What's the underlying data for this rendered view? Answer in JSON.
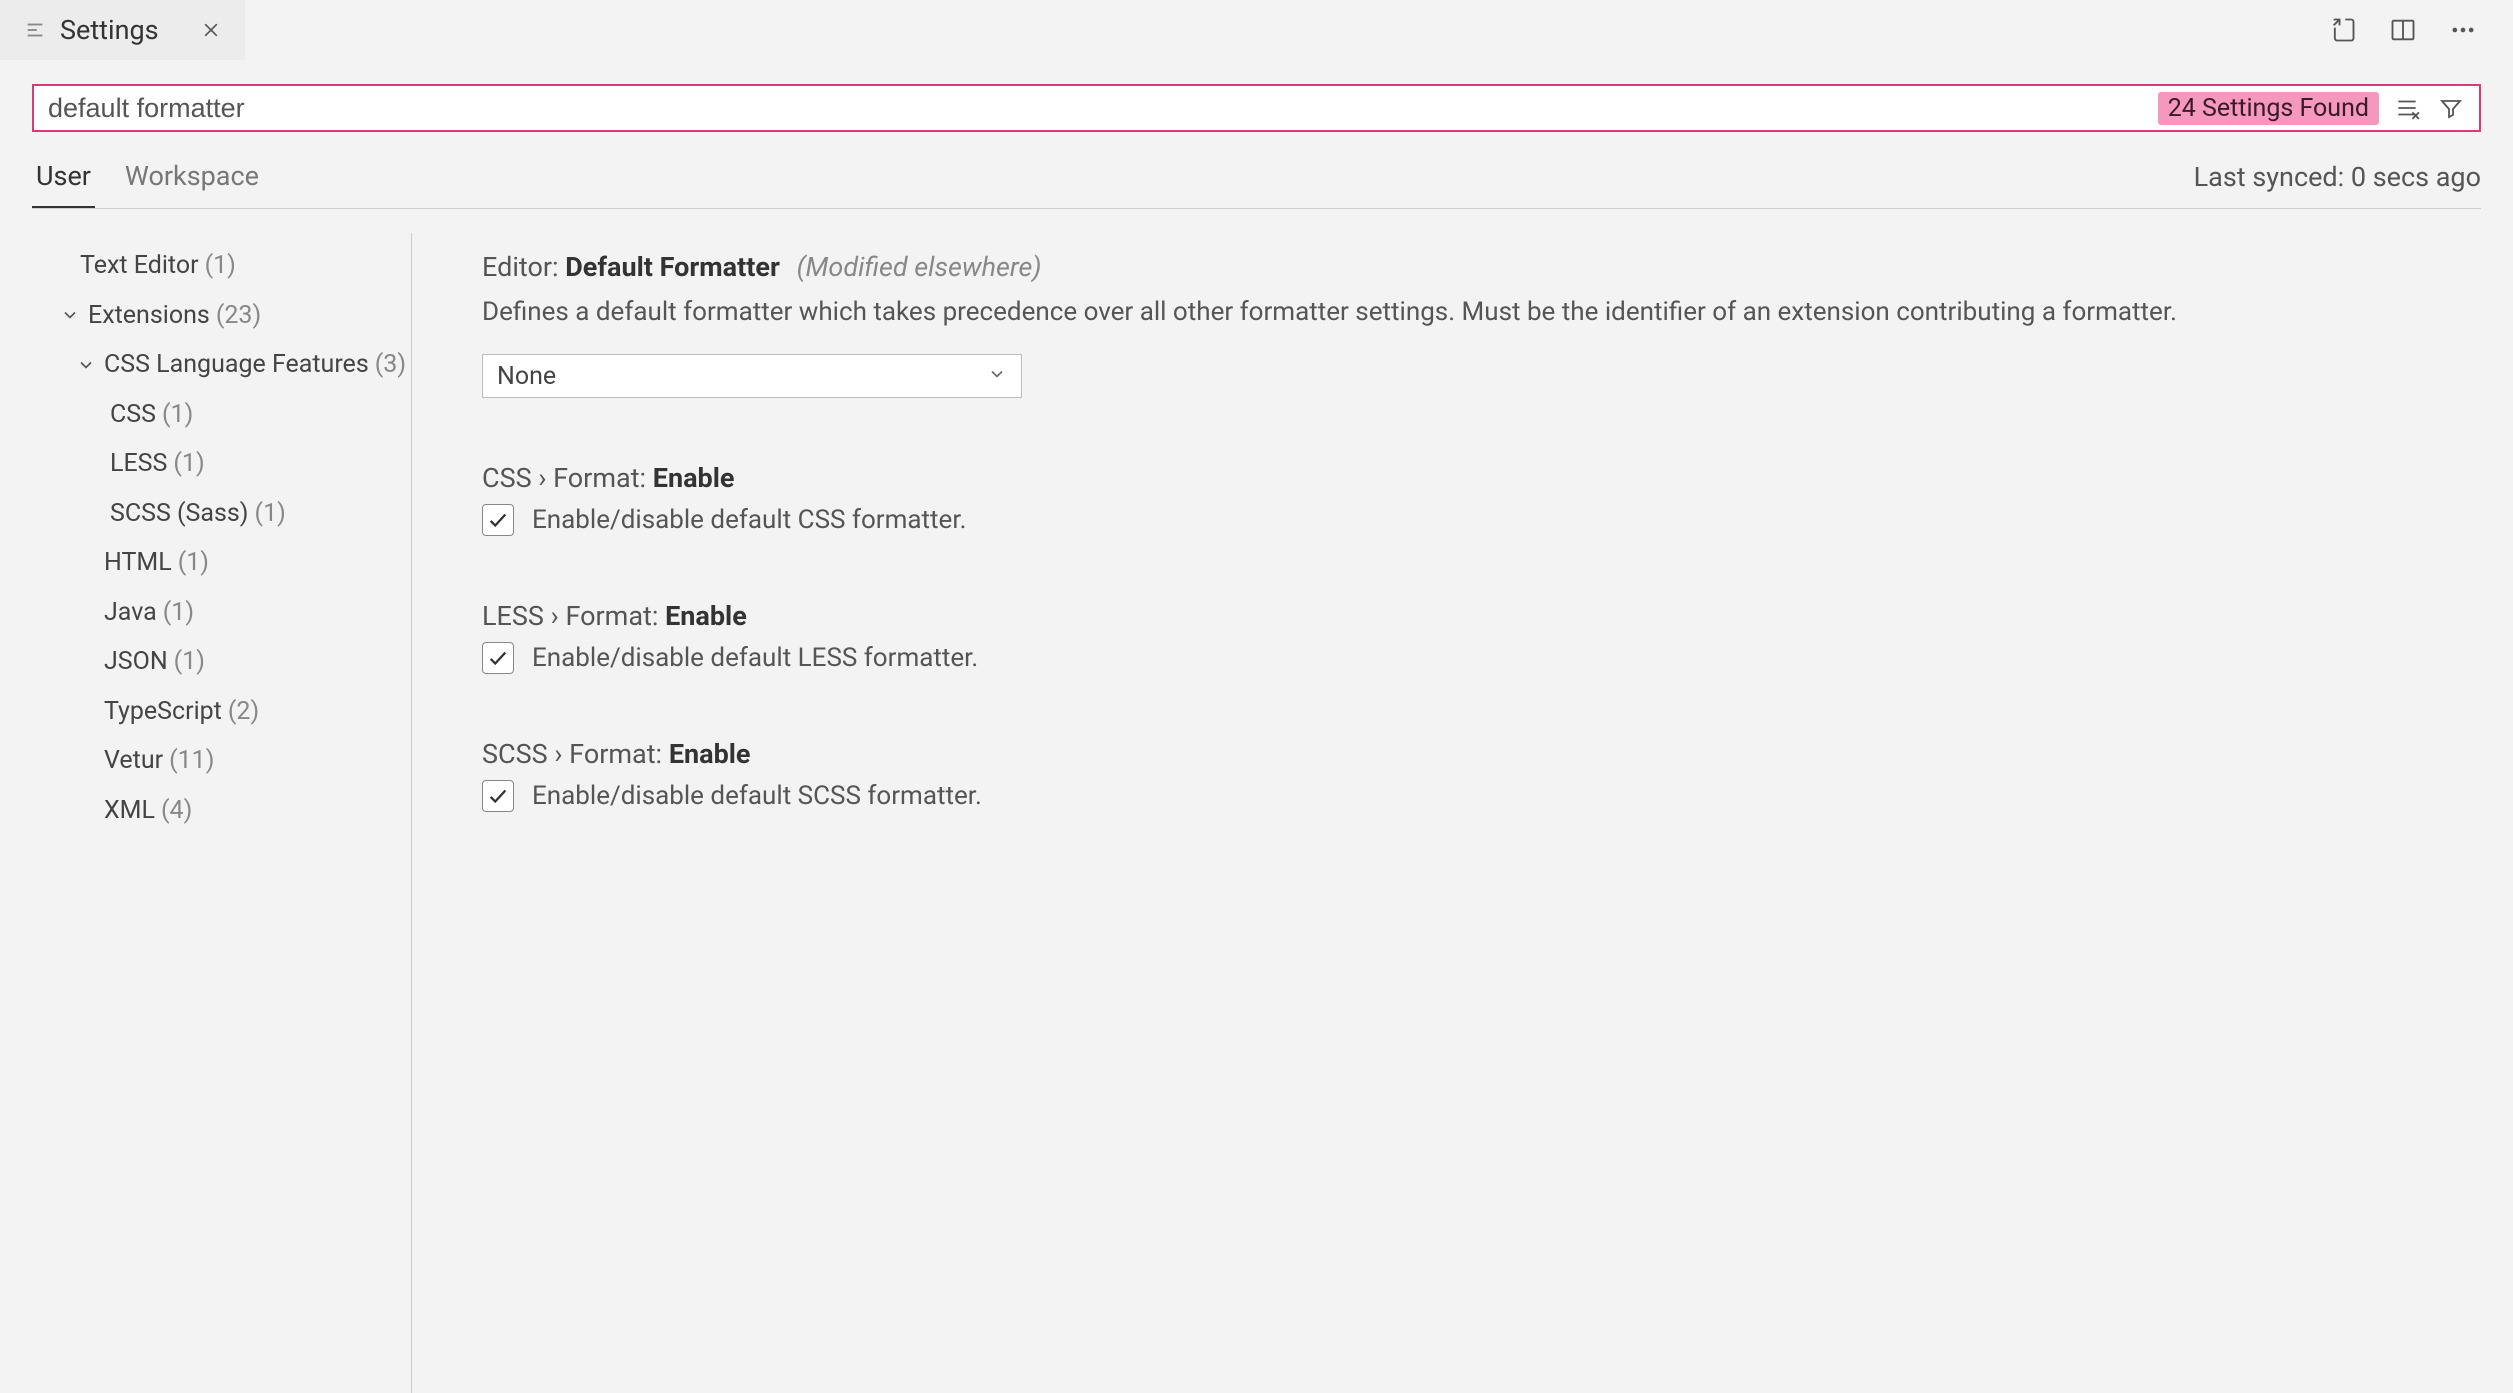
{
  "tab": {
    "title": "Settings"
  },
  "search": {
    "value": "default formatter",
    "count_label": "24 Settings Found"
  },
  "scope_tabs": {
    "user": "User",
    "workspace": "Workspace"
  },
  "sync_status": "Last synced: 0 secs ago",
  "sidebar": {
    "text_editor": {
      "label": "Text Editor",
      "count": "(1)"
    },
    "extensions": {
      "label": "Extensions",
      "count": "(23)"
    },
    "css_lang": {
      "label": "CSS Language Features",
      "count": "(3)"
    },
    "css": {
      "label": "CSS",
      "count": "(1)"
    },
    "less": {
      "label": "LESS",
      "count": "(1)"
    },
    "scss": {
      "label": "SCSS (Sass)",
      "count": "(1)"
    },
    "html": {
      "label": "HTML",
      "count": "(1)"
    },
    "java": {
      "label": "Java",
      "count": "(1)"
    },
    "json": {
      "label": "JSON",
      "count": "(1)"
    },
    "typescript": {
      "label": "TypeScript",
      "count": "(2)"
    },
    "vetur": {
      "label": "Vetur",
      "count": "(11)"
    },
    "xml": {
      "label": "XML",
      "count": "(4)"
    }
  },
  "settings": {
    "default_formatter": {
      "scope": "Editor: ",
      "name": "Default Formatter",
      "modified": "(Modified elsewhere)",
      "desc": "Defines a default formatter which takes precedence over all other formatter settings. Must be the identifier of an extension contributing a formatter.",
      "value": "None"
    },
    "css_format": {
      "scope": "CSS › Format: ",
      "name": "Enable",
      "desc": "Enable/disable default CSS formatter."
    },
    "less_format": {
      "scope": "LESS › Format: ",
      "name": "Enable",
      "desc": "Enable/disable default LESS formatter."
    },
    "scss_format": {
      "scope": "SCSS › Format: ",
      "name": "Enable",
      "desc": "Enable/disable default SCSS formatter."
    }
  }
}
